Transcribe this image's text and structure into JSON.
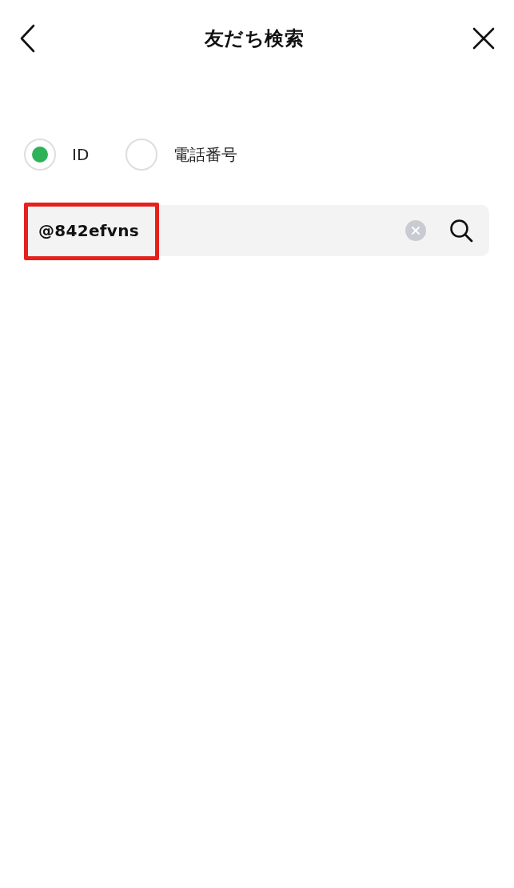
{
  "header": {
    "title": "友だち検索"
  },
  "search_type": [
    {
      "label": "ID",
      "selected": true
    },
    {
      "label": "電話番号",
      "selected": false
    }
  ],
  "search": {
    "value": "@842efvns",
    "highlighted": true
  }
}
